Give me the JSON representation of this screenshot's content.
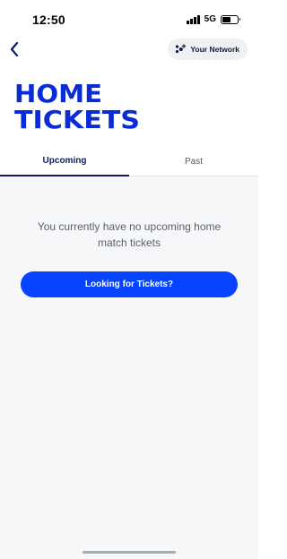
{
  "status_bar": {
    "time": "12:50",
    "network": "5G",
    "signal_bars": 4,
    "battery_level": 0.55
  },
  "header": {
    "back_icon": "chevron-left-icon",
    "network_button": {
      "label": "Your Network",
      "icon": "network-people-icon"
    }
  },
  "logo": {
    "text_lines": [
      "HOME",
      "TICKETS"
    ],
    "color": "#0a2bd6"
  },
  "tabs": [
    {
      "label": "Upcoming",
      "active": true
    },
    {
      "label": "Past",
      "active": false
    }
  ],
  "empty_state": {
    "message": "You currently have no upcoming home match tickets",
    "button_label": "Looking for Tickets?"
  },
  "colors": {
    "accent": "#0644ff",
    "brand_navy": "#0b1c6e",
    "background": "#f6f7f9"
  }
}
